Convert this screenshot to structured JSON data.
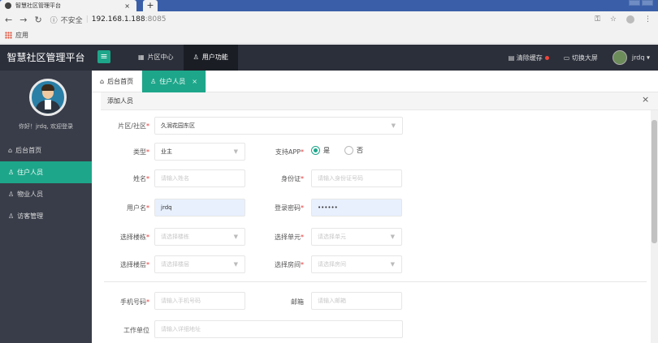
{
  "browser": {
    "tab_title": "智慧社区管理平台",
    "tab_close": "×",
    "new_tab": "+",
    "insecure_label": "不安全",
    "url_host": "192.168.1.188",
    "url_port": ":8085",
    "bookmark_apps": "应用"
  },
  "header": {
    "app_title": "智慧社区管理平台",
    "menu_icon": "≡",
    "nav": [
      {
        "label": "片区中心",
        "icon": "building-icon"
      },
      {
        "label": "用户功能",
        "icon": "user-icon"
      }
    ],
    "clear_cache": "清除缓存",
    "switch_screen": "切换大屏",
    "username": "jrdq"
  },
  "sidebar": {
    "welcome": "你好！jrdq, 欢迎登录",
    "items": [
      {
        "label": "后台首页"
      },
      {
        "label": "住户人员"
      },
      {
        "label": "物业人员"
      },
      {
        "label": "访客管理"
      }
    ]
  },
  "page_tabs": [
    {
      "label": "后台首页"
    },
    {
      "label": "住户人员",
      "close": "×"
    }
  ],
  "panel": {
    "title": "添加人员",
    "close": "×"
  },
  "form": {
    "area": {
      "label": "片区/社区",
      "value": "久润花园东区"
    },
    "type": {
      "label": "类型",
      "value": "业主"
    },
    "support_app": {
      "label": "支持APP",
      "options": [
        "是",
        "否"
      ],
      "selected": "是"
    },
    "name": {
      "label": "姓名",
      "placeholder": "请输入姓名"
    },
    "id_card": {
      "label": "身份证",
      "placeholder": "请输入身份证号码"
    },
    "username": {
      "label": "用户名",
      "value": "jrdq"
    },
    "password": {
      "label": "登录密码",
      "value": "••••••"
    },
    "building": {
      "label": "选择楼栋",
      "placeholder": "请选择楼栋"
    },
    "unit": {
      "label": "选择单元",
      "placeholder": "请选择单元"
    },
    "floor": {
      "label": "选择楼层",
      "placeholder": "请选择楼层"
    },
    "room": {
      "label": "选择房间",
      "placeholder": "请选择房间"
    },
    "phone": {
      "label": "手机号码",
      "placeholder": "请输入手机号码"
    },
    "email": {
      "label": "邮箱",
      "placeholder": "请输入邮箱"
    },
    "workplace": {
      "label": "工作单位",
      "placeholder": "请输入详细地址"
    },
    "required_mark": "*"
  },
  "colors": {
    "accent": "#1ea68a",
    "header_bg": "#2b2f3a",
    "sidebar_bg": "#393d49"
  }
}
